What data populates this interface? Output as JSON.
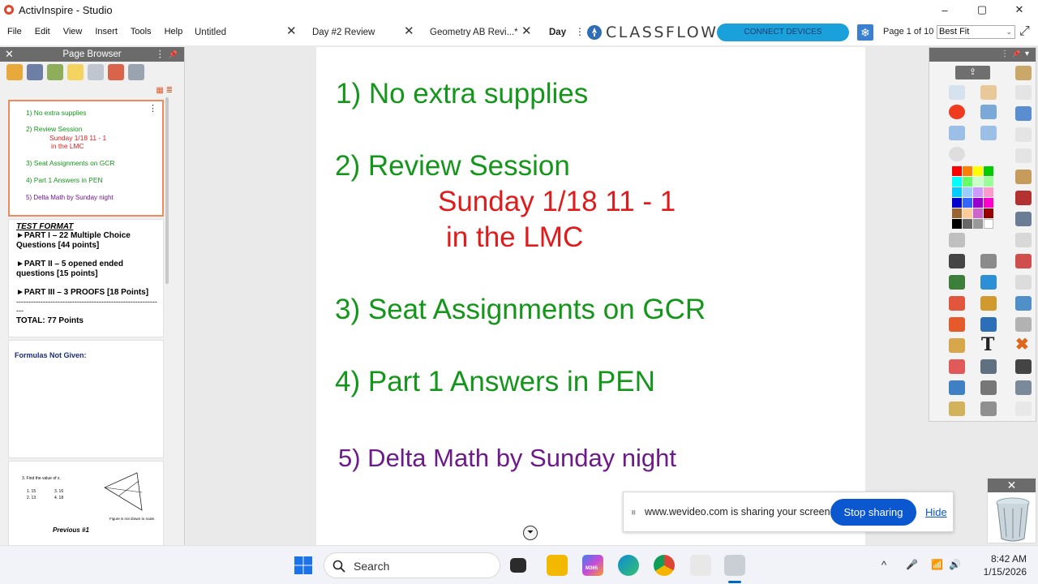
{
  "window": {
    "title": "ActivInspire - Studio",
    "minimize": "–",
    "maximize": "▢",
    "close": "✕"
  },
  "menu": [
    "File",
    "Edit",
    "View",
    "Insert",
    "Tools",
    "Help"
  ],
  "tabs": [
    {
      "label": "Untitled",
      "close": "✕"
    },
    {
      "label": "Day #2 Review",
      "close": "✕"
    },
    {
      "label": "Geometry AB Revi...*",
      "close": "✕"
    },
    {
      "label": "Day"
    }
  ],
  "header": {
    "kebab": "⋮",
    "classflow": "CLASSFLOW",
    "connect": "CONNECT DEVICES",
    "page_of": "Page 1 of 10",
    "fit": "Best Fit",
    "fit_caret": "⌄",
    "expand": "⤢"
  },
  "page_browser": {
    "title": "Page Browser",
    "close": "✕",
    "dots": "⋮",
    "pin": "📌",
    "view_icons": "▦ ≣",
    "thumb1": {
      "menu": "⋮",
      "l1": "1) No extra supplies",
      "l2": "2) Review Session",
      "l3": "Sunday 1/18 11 - 1",
      "l4": "in the LMC",
      "l5": "3) Seat Assignments on GCR",
      "l6": "4) Part 1 Answers in PEN",
      "l7": "5) Delta Math by Sunday night"
    },
    "thumb2": {
      "h": "TEST FORMAT",
      "p1": "►PART I – 22 Multiple Choice Questions [44 points]",
      "p2": "►PART II – 5 opened ended questions [15 points]",
      "p3": "►PART III – 3 PROOFS [18 Points]",
      "dash": "-------------------------------------------------------------",
      "total": "TOTAL: 77 Points"
    },
    "thumb3": {
      "h": "Formulas Not Given:"
    },
    "thumb4": {
      "a": "3. Find the value of x.",
      "b1": "1. 15",
      "b2": "3. 16",
      "c1": "2. 13",
      "c2": "4. 18",
      "d": "Figure is not drawn to scale.",
      "e": "Previous #1"
    }
  },
  "slide": {
    "l1": "1) No extra supplies",
    "l2": "2) Review Session",
    "l3": "Sunday 1/18 11 - 1",
    "l4": "in the LMC",
    "l5": "3) Seat Assignments on GCR",
    "l6": "4) Part 1 Answers in PEN",
    "l7": "5) Delta Math by Sunday night",
    "nav": "⏷",
    "colors": {
      "green": "#14961b",
      "red": "#e01b1b",
      "purple": "#6d1a8a"
    }
  },
  "toolbox": {
    "dots": "⋮",
    "pin": "📌",
    "caret": "▾",
    "share": "⇪",
    "text_tool": "T",
    "swatches": [
      "#ff0000",
      "#ff8000",
      "#ffff00",
      "#00cc00",
      "#00ffff",
      "#66ff66",
      "#ccffcc",
      "#99ff99",
      "#00ccff",
      "#99ccff",
      "#cc99ff",
      "#ff99cc",
      "#0000cc",
      "#3366ff",
      "#9900cc",
      "#ff00cc",
      "#996633",
      "#ffcc99",
      "#cc66cc",
      "#990000",
      "#000000",
      "#666666",
      "#999999",
      "#ffffff"
    ]
  },
  "share_bar": {
    "grip": "⏸",
    "message": "www.wevideo.com is sharing your screen.",
    "stop": "Stop sharing",
    "hide": "Hide"
  },
  "recycle": {
    "close": "✕"
  },
  "taskbar": {
    "search": "Search",
    "m365": "M365",
    "chevron": "^",
    "mic": "🎤",
    "wifi": "📶",
    "volume": "🔊",
    "time": "8:42 AM",
    "date": "1/15/2026"
  }
}
